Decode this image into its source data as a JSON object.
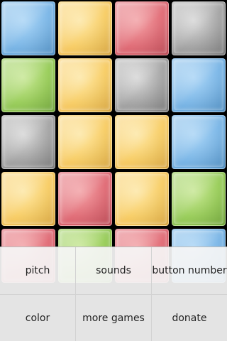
{
  "board": {
    "rows": [
      [
        "blue",
        "yellow",
        "red",
        "gray"
      ],
      [
        "green",
        "yellow",
        "gray",
        "blue"
      ],
      [
        "gray",
        "yellow",
        "yellow",
        "blue"
      ],
      [
        "yellow",
        "red",
        "yellow",
        "green"
      ],
      [
        "red",
        "green",
        "red",
        "blue"
      ]
    ],
    "colors": {
      "blue": "#7fb9e8",
      "yellow": "#f8cf6a",
      "red": "#e2707a",
      "gray": "#a9a9a9",
      "green": "#9ccf5e"
    }
  },
  "menu": {
    "items": [
      {
        "label": "pitch"
      },
      {
        "label": "sounds"
      },
      {
        "label": "button number"
      },
      {
        "label": "color"
      },
      {
        "label": "more games"
      },
      {
        "label": "donate"
      }
    ]
  }
}
